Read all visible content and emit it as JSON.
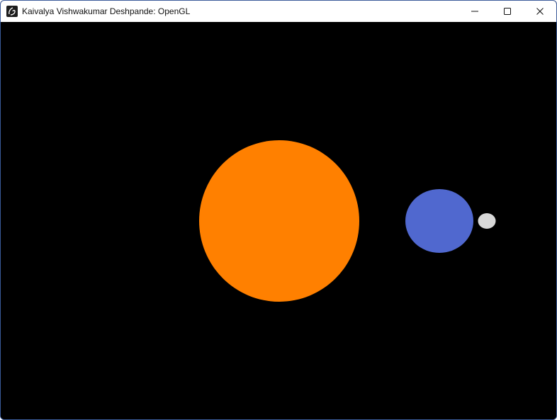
{
  "window": {
    "title": "Kaivalya Vishwakumar Deshpande: OpenGL",
    "icon": "opengl-app-icon",
    "controls": {
      "minimize_icon": "minimize-icon",
      "maximize_icon": "maximize-icon",
      "close_icon": "close-icon"
    }
  },
  "scene": {
    "background_color": "#000000",
    "bodies": [
      {
        "name": "sun",
        "color": "#ff8000"
      },
      {
        "name": "planet",
        "color": "#5068cf"
      },
      {
        "name": "moon",
        "color": "#d8d8d8"
      }
    ]
  }
}
